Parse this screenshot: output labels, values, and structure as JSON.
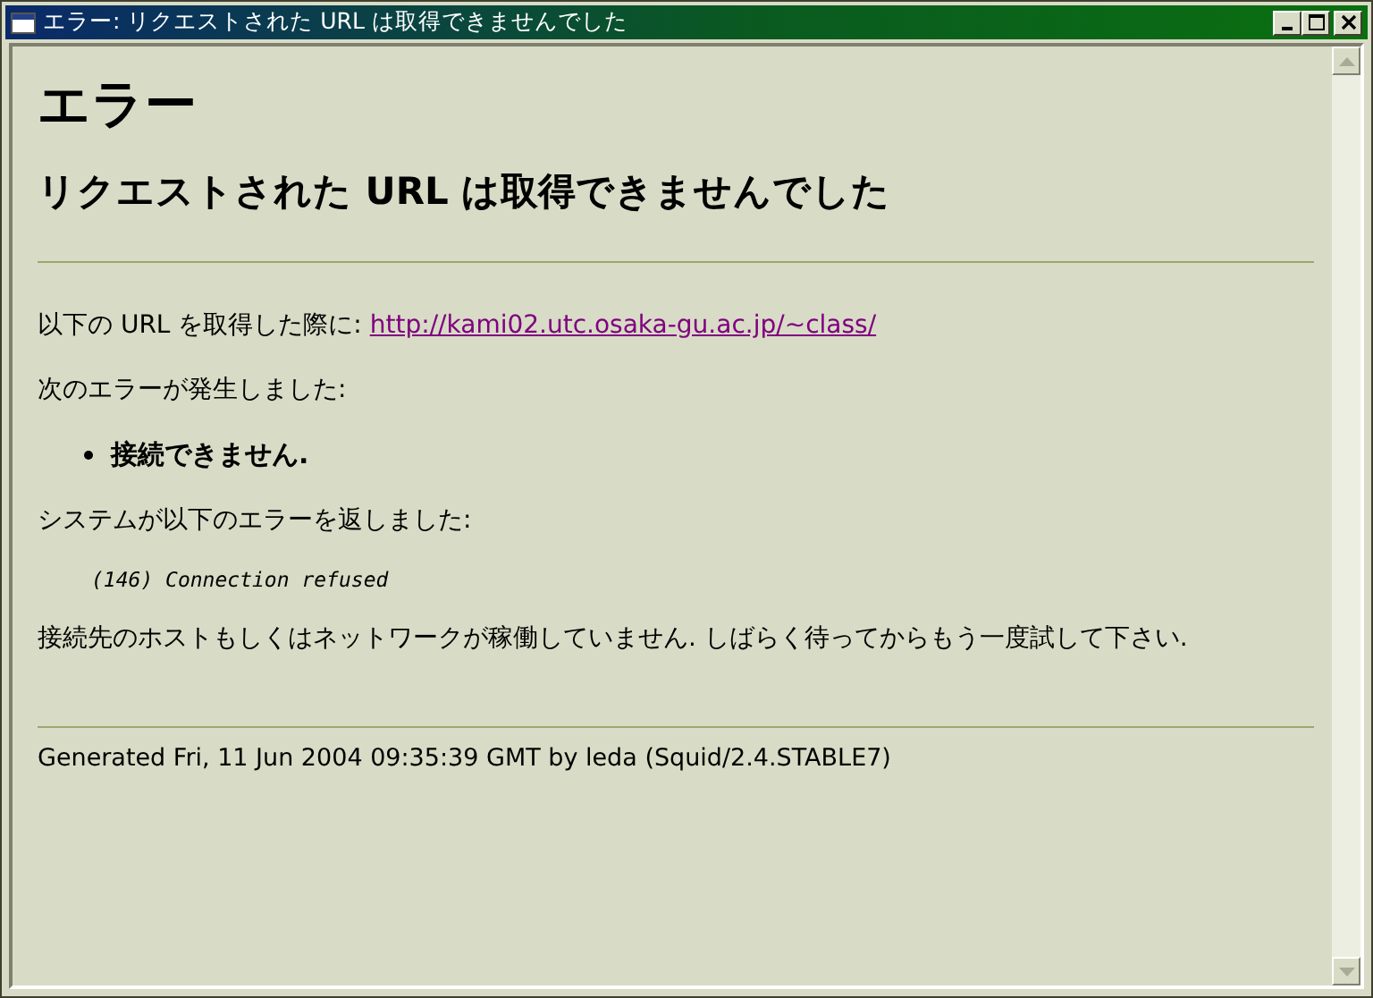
{
  "window": {
    "title": "エラー: リクエストされた URL は取得できませんでした"
  },
  "heading": "エラー",
  "subheading": "リクエストされた URL は取得できませんでした",
  "url_line": {
    "text": "以下の URL を取得した際に:",
    "link": "http://kami02.utc.osaka-gu.ac.jp/~class/"
  },
  "error_intro": "次のエラーが発生しました:",
  "errors": [
    "接続できません."
  ],
  "system_intro": "システムが以下のエラーを返しました:",
  "system_error": "(146) Connection refused",
  "explanation": "接続先のホストもしくはネットワークが稼働していません. しばらく待ってからもう一度試して下さい.",
  "footer": "Generated Fri, 11 Jun 2004 09:35:39 GMT by leda (Squid/2.4.STABLE7)"
}
